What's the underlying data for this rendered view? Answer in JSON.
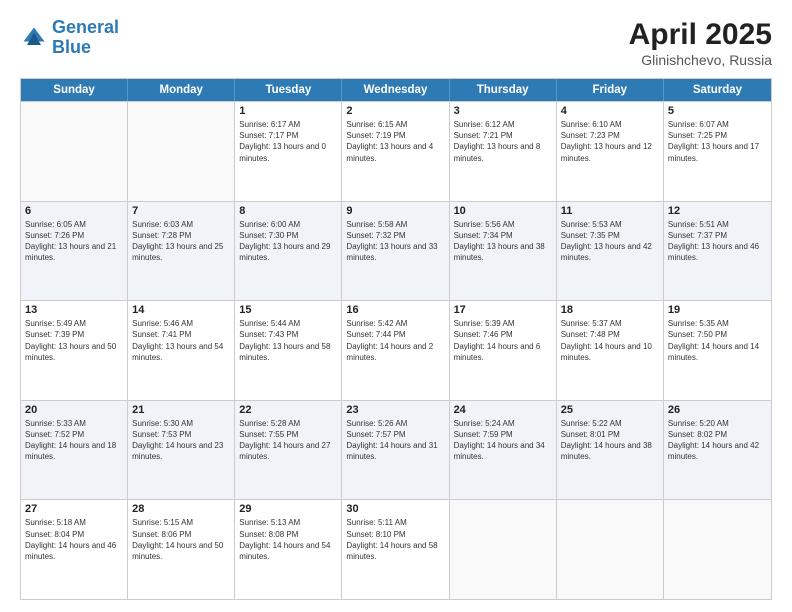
{
  "logo": {
    "text_general": "General",
    "text_blue": "Blue"
  },
  "title": "April 2025",
  "subtitle": "Glinishchevo, Russia",
  "headers": [
    "Sunday",
    "Monday",
    "Tuesday",
    "Wednesday",
    "Thursday",
    "Friday",
    "Saturday"
  ],
  "rows": [
    {
      "alt": false,
      "cells": [
        {
          "day": "",
          "info": ""
        },
        {
          "day": "",
          "info": ""
        },
        {
          "day": "1",
          "info": "Sunrise: 6:17 AM\nSunset: 7:17 PM\nDaylight: 13 hours and 0 minutes."
        },
        {
          "day": "2",
          "info": "Sunrise: 6:15 AM\nSunset: 7:19 PM\nDaylight: 13 hours and 4 minutes."
        },
        {
          "day": "3",
          "info": "Sunrise: 6:12 AM\nSunset: 7:21 PM\nDaylight: 13 hours and 8 minutes."
        },
        {
          "day": "4",
          "info": "Sunrise: 6:10 AM\nSunset: 7:23 PM\nDaylight: 13 hours and 12 minutes."
        },
        {
          "day": "5",
          "info": "Sunrise: 6:07 AM\nSunset: 7:25 PM\nDaylight: 13 hours and 17 minutes."
        }
      ]
    },
    {
      "alt": true,
      "cells": [
        {
          "day": "6",
          "info": "Sunrise: 6:05 AM\nSunset: 7:26 PM\nDaylight: 13 hours and 21 minutes."
        },
        {
          "day": "7",
          "info": "Sunrise: 6:03 AM\nSunset: 7:28 PM\nDaylight: 13 hours and 25 minutes."
        },
        {
          "day": "8",
          "info": "Sunrise: 6:00 AM\nSunset: 7:30 PM\nDaylight: 13 hours and 29 minutes."
        },
        {
          "day": "9",
          "info": "Sunrise: 5:58 AM\nSunset: 7:32 PM\nDaylight: 13 hours and 33 minutes."
        },
        {
          "day": "10",
          "info": "Sunrise: 5:56 AM\nSunset: 7:34 PM\nDaylight: 13 hours and 38 minutes."
        },
        {
          "day": "11",
          "info": "Sunrise: 5:53 AM\nSunset: 7:35 PM\nDaylight: 13 hours and 42 minutes."
        },
        {
          "day": "12",
          "info": "Sunrise: 5:51 AM\nSunset: 7:37 PM\nDaylight: 13 hours and 46 minutes."
        }
      ]
    },
    {
      "alt": false,
      "cells": [
        {
          "day": "13",
          "info": "Sunrise: 5:49 AM\nSunset: 7:39 PM\nDaylight: 13 hours and 50 minutes."
        },
        {
          "day": "14",
          "info": "Sunrise: 5:46 AM\nSunset: 7:41 PM\nDaylight: 13 hours and 54 minutes."
        },
        {
          "day": "15",
          "info": "Sunrise: 5:44 AM\nSunset: 7:43 PM\nDaylight: 13 hours and 58 minutes."
        },
        {
          "day": "16",
          "info": "Sunrise: 5:42 AM\nSunset: 7:44 PM\nDaylight: 14 hours and 2 minutes."
        },
        {
          "day": "17",
          "info": "Sunrise: 5:39 AM\nSunset: 7:46 PM\nDaylight: 14 hours and 6 minutes."
        },
        {
          "day": "18",
          "info": "Sunrise: 5:37 AM\nSunset: 7:48 PM\nDaylight: 14 hours and 10 minutes."
        },
        {
          "day": "19",
          "info": "Sunrise: 5:35 AM\nSunset: 7:50 PM\nDaylight: 14 hours and 14 minutes."
        }
      ]
    },
    {
      "alt": true,
      "cells": [
        {
          "day": "20",
          "info": "Sunrise: 5:33 AM\nSunset: 7:52 PM\nDaylight: 14 hours and 18 minutes."
        },
        {
          "day": "21",
          "info": "Sunrise: 5:30 AM\nSunset: 7:53 PM\nDaylight: 14 hours and 23 minutes."
        },
        {
          "day": "22",
          "info": "Sunrise: 5:28 AM\nSunset: 7:55 PM\nDaylight: 14 hours and 27 minutes."
        },
        {
          "day": "23",
          "info": "Sunrise: 5:26 AM\nSunset: 7:57 PM\nDaylight: 14 hours and 31 minutes."
        },
        {
          "day": "24",
          "info": "Sunrise: 5:24 AM\nSunset: 7:59 PM\nDaylight: 14 hours and 34 minutes."
        },
        {
          "day": "25",
          "info": "Sunrise: 5:22 AM\nSunset: 8:01 PM\nDaylight: 14 hours and 38 minutes."
        },
        {
          "day": "26",
          "info": "Sunrise: 5:20 AM\nSunset: 8:02 PM\nDaylight: 14 hours and 42 minutes."
        }
      ]
    },
    {
      "alt": false,
      "cells": [
        {
          "day": "27",
          "info": "Sunrise: 5:18 AM\nSunset: 8:04 PM\nDaylight: 14 hours and 46 minutes."
        },
        {
          "day": "28",
          "info": "Sunrise: 5:15 AM\nSunset: 8:06 PM\nDaylight: 14 hours and 50 minutes."
        },
        {
          "day": "29",
          "info": "Sunrise: 5:13 AM\nSunset: 8:08 PM\nDaylight: 14 hours and 54 minutes."
        },
        {
          "day": "30",
          "info": "Sunrise: 5:11 AM\nSunset: 8:10 PM\nDaylight: 14 hours and 58 minutes."
        },
        {
          "day": "",
          "info": ""
        },
        {
          "day": "",
          "info": ""
        },
        {
          "day": "",
          "info": ""
        }
      ]
    }
  ]
}
